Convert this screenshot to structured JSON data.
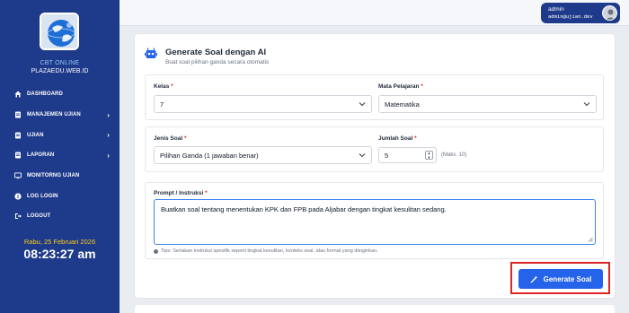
{
  "sidebar": {
    "brand_line1": "CBT ONLINE",
    "brand_line2": "PLAZAEDU.WEB.ID",
    "items": [
      {
        "label": "DASHBOARD",
        "icon": "home-icon",
        "has_submenu": false
      },
      {
        "label": "MANAJEMEN UJIAN",
        "icon": "document-icon",
        "has_submenu": true
      },
      {
        "label": "UJIAN",
        "icon": "document-icon",
        "has_submenu": true
      },
      {
        "label": "LAPORAN",
        "icon": "document-icon",
        "has_submenu": true
      },
      {
        "label": "MONITORNG UJIAN",
        "icon": "monitor-icon",
        "has_submenu": false
      },
      {
        "label": "LOG LOGIN",
        "icon": "info-icon",
        "has_submenu": false
      },
      {
        "label": "LOGOUT",
        "icon": "logout-icon",
        "has_submenu": false
      }
    ],
    "date": "Rabu, 25 Februari 2026",
    "time": "08:23:27 am"
  },
  "topbar": {
    "username": "admin",
    "email": "admin@ujian.dev"
  },
  "card": {
    "title": "Generate Soal dengan AI",
    "subtitle": "Buat soal pilihan ganda secara otomatis",
    "kelas": {
      "label": "Kelas",
      "value": "7"
    },
    "mapel": {
      "label": "Mata Pelajaran",
      "value": "Matematika"
    },
    "jenis": {
      "label": "Jenis Soal",
      "value": "Pilihan Ganda (1 jawaban benar)"
    },
    "jumlah": {
      "label": "Jumlah Soal",
      "value": "5",
      "hint": "(Maks. 10)"
    },
    "prompt": {
      "label": "Prompt / Instruksi",
      "value": "Buatkan soal tentang menentukan KPK dan FPB pada Aljabar dengan tingkat kesulitan sedang.",
      "tips": "Tips: Sertakan instruksi spesifik seperti tingkat kesulitan, konteks soal, atau format yang diinginkan."
    },
    "button_label": "Generate Soal"
  },
  "colors": {
    "sidebar": "#1e3a8a",
    "accent": "#2563eb",
    "highlight": "#dc2626",
    "date": "#facc15"
  }
}
